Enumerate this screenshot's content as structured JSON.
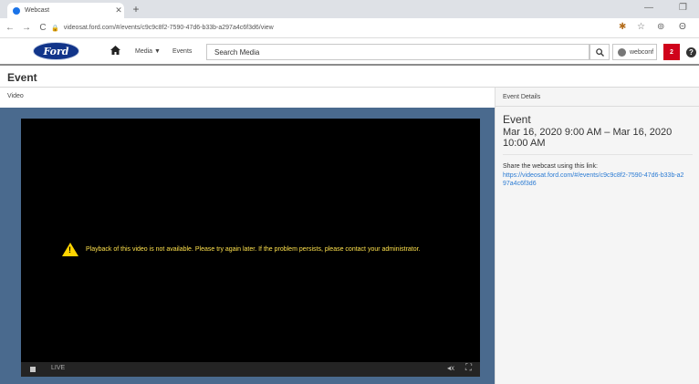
{
  "browser": {
    "tab_title": "Webcast",
    "new_tab_symbol": "+",
    "url": "videosat.ford.com/#/events/c9c9c8f2-7590-47d6-b33b-a297a4c6f3d6/view",
    "nav": {
      "back": "←",
      "forward": "→",
      "reload": "C",
      "home": "⌂"
    },
    "window_controls": {
      "minimize": "—",
      "maximize": "❐"
    },
    "toolbar_icons": {
      "extension": "✱",
      "bookmark": "☆",
      "settings": "⊚",
      "profile": "Θ"
    }
  },
  "app": {
    "logo_text": "Ford",
    "home_icon": "▲",
    "nav_media": "Media ▼",
    "nav_events": "Events",
    "search_placeholder": "Search Media",
    "search_icon_glyph": "⌕",
    "user_name": "webconf",
    "notification_count": "2",
    "help_glyph": "?"
  },
  "page": {
    "title": "Event",
    "video_label": "Video"
  },
  "player": {
    "error_message": "Playback of this video is not available. Please try again later. If the problem persists, please contact your administrator.",
    "warning_glyph": "!",
    "live_label": "LIVE",
    "volume_glyph": "◂x",
    "fullscreen_glyph": "⛶"
  },
  "event_details": {
    "header": "Event Details",
    "name": "Event",
    "time": "Mar 16, 2020 9:00 AM – Mar 16, 2020 10:00 AM",
    "share_label": "Share the webcast using this link:",
    "share_link": "https://videosat.ford.com/#/events/c9c9c8f2-7590-47d6-b33b-a297a4c6f3d6"
  },
  "colors": {
    "brand_blue": "#12358a",
    "notification_red": "#d0021b",
    "link_blue": "#2b7bd3",
    "warning_yellow": "#ffd400"
  }
}
